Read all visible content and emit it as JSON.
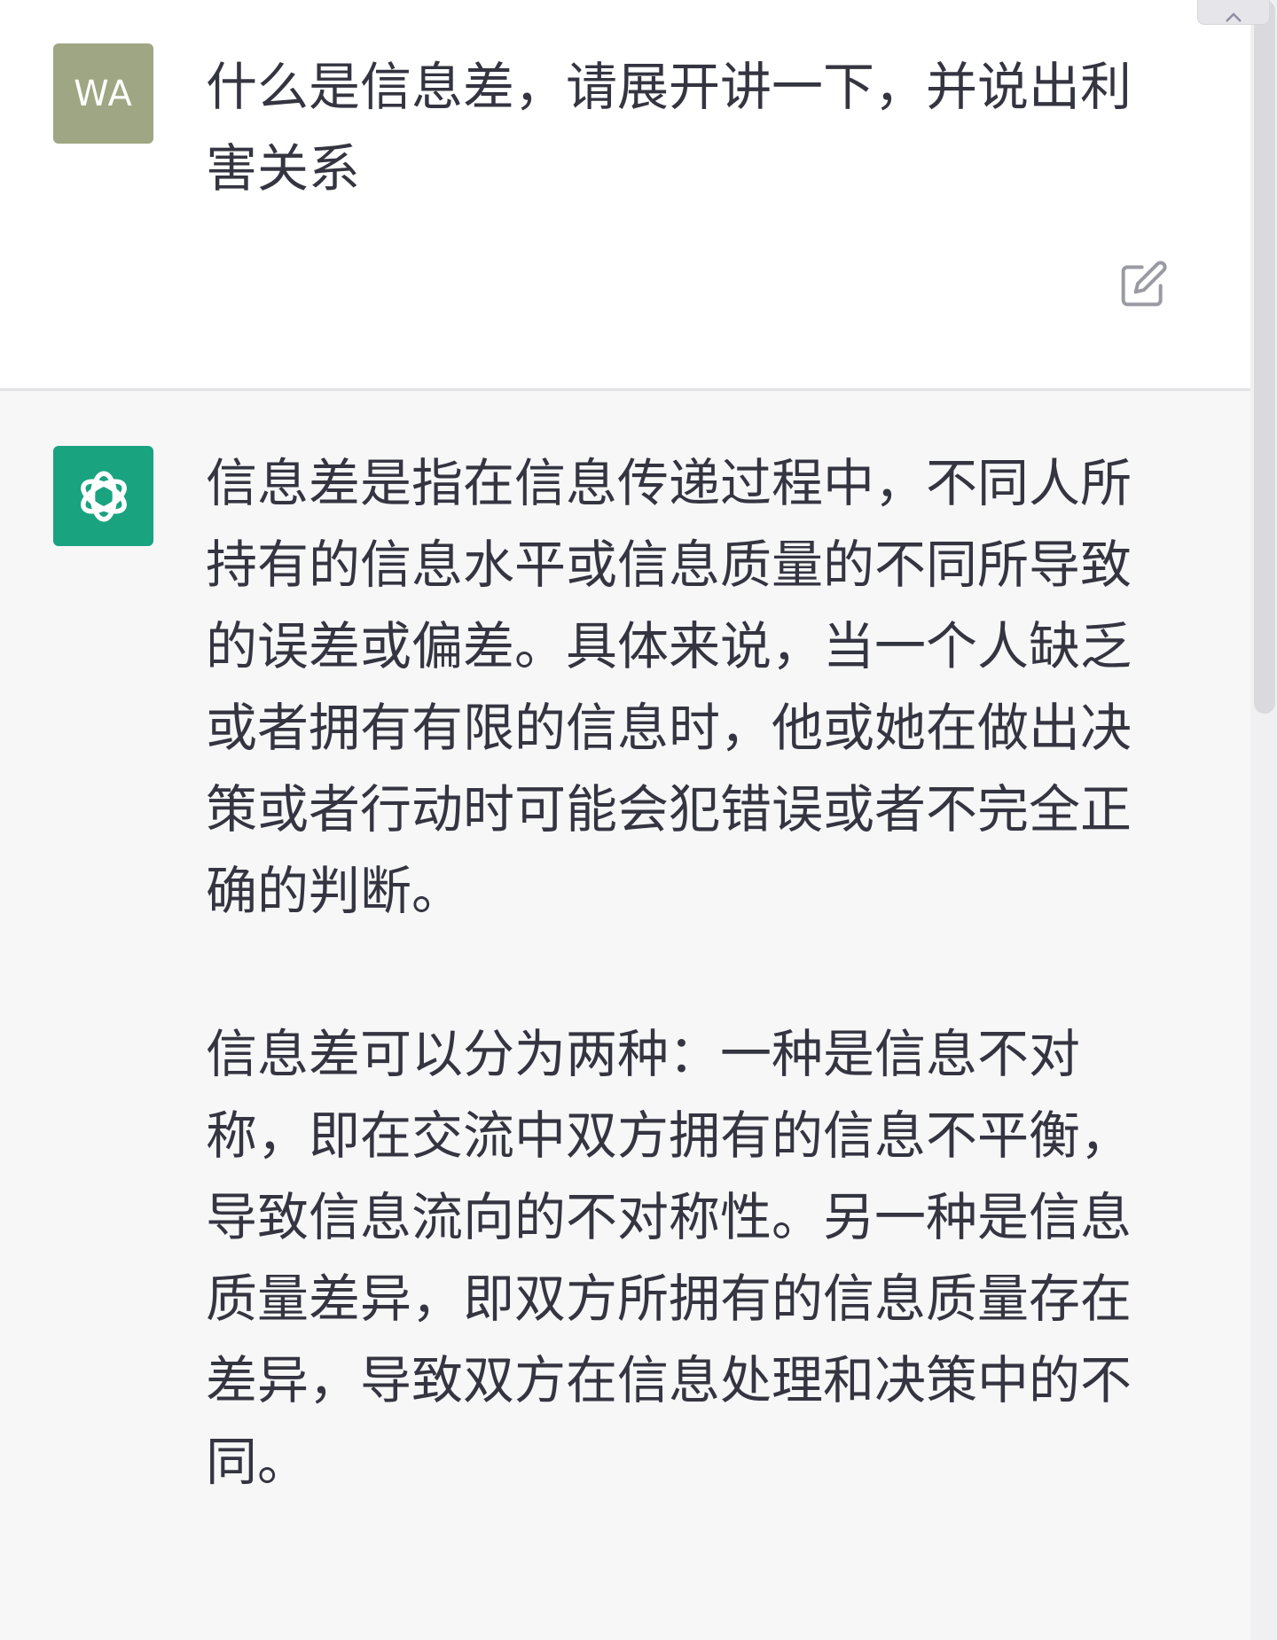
{
  "user_turn": {
    "avatar_initials": "WA",
    "avatar_color": "#9fa683",
    "message": "什么是信息差，请展开讲一下，并说出利害关系",
    "edit_icon": "edit-icon"
  },
  "assistant_turn": {
    "avatar_icon": "openai-logo-icon",
    "avatar_color": "#19a37f",
    "paragraphs": [
      "信息差是指在信息传递过程中，不同人所持有的信息水平或信息质量的不同所导致的误差或偏差。具体来说，当一个人缺乏或者拥有有限的信息时，他或她在做出决策或者行动时可能会犯错误或者不完全正确的判断。",
      "信息差可以分为两种：一种是信息不对称，即在交流中双方拥有的信息不平衡，导致信息流向的不对称性。另一种是信息质量差异，即双方所拥有的信息质量存在差异，导致双方在信息处理和决策中的不同。"
    ]
  },
  "colors": {
    "text": "#343541",
    "user_background": "#ffffff",
    "assistant_background": "#f7f7f8"
  }
}
